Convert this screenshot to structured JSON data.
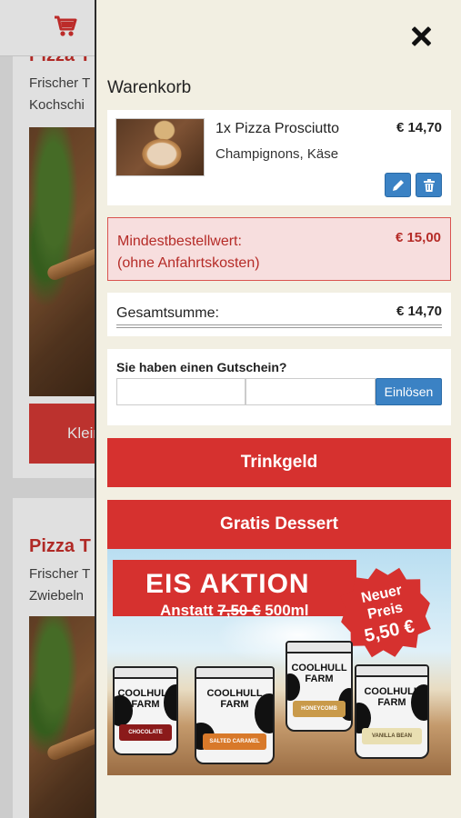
{
  "background_page": {
    "products": [
      {
        "title": "Pizza T",
        "desc_lines": [
          "Frischer T",
          "Kochschi"
        ],
        "button": "Klein"
      },
      {
        "title": "Pizza T",
        "desc_lines": [
          "Frischer T",
          "Zwiebeln"
        ],
        "button": ""
      }
    ]
  },
  "cart": {
    "title": "Warenkorb",
    "close_icon": "close-icon",
    "item": {
      "name": "1x Pizza Prosciutto",
      "extras": "Champignons, Käse",
      "price": "€ 14,70",
      "edit_icon": "pencil-icon",
      "delete_icon": "trash-icon"
    },
    "minimum": {
      "label_line1": "Mindestbestellwert:",
      "label_line2": "(ohne Anfahrtskosten)",
      "value": "€ 15,00"
    },
    "total": {
      "label": "Gesamtsumme:",
      "value": "€ 14,70"
    },
    "coupon": {
      "question": "Sie haben einen Gutschein?",
      "input_value": "",
      "button": "Einlösen"
    },
    "tip_button": "Trinkgeld",
    "dessert_button": "Gratis Dessert",
    "banner": {
      "title": "EIS AKTION",
      "sub_prefix": "Anstatt",
      "old_price": "7,50 €",
      "volume": "500ml",
      "badge_line1": "Neuer",
      "badge_line2": "Preis",
      "new_price": "5,50 €",
      "tubs": [
        {
          "brand_line1": "COOLHULL",
          "brand_line2": "FARM",
          "flavor": "CHOCOLATE",
          "color": "#8b1a1a"
        },
        {
          "brand_line1": "COOLHULL",
          "brand_line2": "FARM",
          "flavor": "SALTED CARAMEL",
          "color": "#d8792a"
        },
        {
          "brand_line1": "COOLHULL",
          "brand_line2": "FARM",
          "flavor": "HONEYCOMB",
          "color": "#c99a4a"
        },
        {
          "brand_line1": "COOLHULL",
          "brand_line2": "FARM",
          "flavor": "VANILLA BEAN",
          "color": "#e9dfb2"
        }
      ]
    }
  },
  "colors": {
    "accent_red": "#d6312f",
    "button_blue": "#3b82c4",
    "drawer_bg": "#f2efe2"
  }
}
